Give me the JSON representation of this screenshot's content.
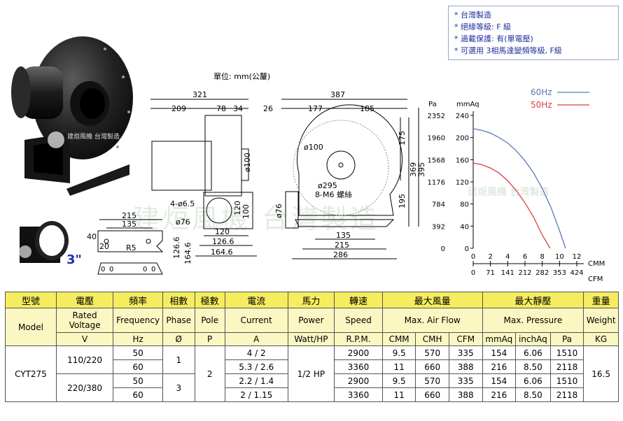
{
  "notes": [
    "* 台灣製造",
    "* 絕緣等級: F 級",
    "* 過載保護: 有(單電壓)",
    "* 可選用 3相馬達變頻等級, F級"
  ],
  "unit_label": "單位: mm(公釐)",
  "brand_watermark": "建烜風機 台灣製造",
  "brand_badge": "建烜風機 台灣製造",
  "flange_size": "3\"",
  "side_view": {
    "dims": [
      "321",
      "209",
      "78",
      "34",
      "4-ø6.5",
      "ø76",
      "ø100",
      "120",
      "100",
      "120",
      "126.6",
      "164.6"
    ]
  },
  "front_view": {
    "dims": [
      "387",
      "26",
      "177",
      "185",
      "ø100",
      "ø295",
      "8-M6 螺絲",
      "ø76",
      "135",
      "215",
      "286",
      "175",
      "195",
      "369",
      "395"
    ]
  },
  "flange_view": {
    "dims": [
      "215",
      "135",
      "40",
      "20",
      "R5",
      "126.6",
      "164.6"
    ]
  },
  "chart_data": {
    "type": "line",
    "y_left_unit": "Pa",
    "y_right_unit": "mmAq",
    "y_pa_ticks": [
      "2352",
      "1960",
      "1568",
      "1176",
      "784",
      "392",
      "0"
    ],
    "y_mmaq_ticks": [
      "240",
      "200",
      "160",
      "120",
      "80",
      "40",
      "0"
    ],
    "x_cmm_unit": "CMM",
    "x_cfm_unit": "CFM",
    "x_cmm_ticks": [
      "0",
      "2",
      "4",
      "6",
      "8",
      "10",
      "12"
    ],
    "x_cfm_ticks": [
      "0",
      "71",
      "141",
      "212",
      "282",
      "353",
      "424"
    ],
    "ylim_mmaq": [
      0,
      240
    ],
    "xlim_cmm": [
      0,
      12
    ],
    "legend_position": "top-right",
    "grid": false,
    "series": [
      {
        "name": "60Hz",
        "color": "#5a78b8",
        "x": [
          0,
          1,
          2,
          3,
          4,
          5,
          6,
          7,
          8,
          9,
          10,
          10.7
        ],
        "y": [
          216,
          213,
          208,
          200,
          190,
          176,
          158,
          136,
          108,
          74,
          32,
          0
        ]
      },
      {
        "name": "50Hz",
        "color": "#d84040",
        "x": [
          0,
          1,
          2,
          3,
          4,
          5,
          6,
          7,
          8,
          8.9
        ],
        "y": [
          154,
          151,
          145,
          136,
          122,
          104,
          82,
          56,
          24,
          0
        ]
      }
    ]
  },
  "table": {
    "header1": [
      "型號",
      "電壓",
      "頻率",
      "相數",
      "極數",
      "電流",
      "馬力",
      "轉速",
      "最大風量",
      "最大靜壓",
      "重量"
    ],
    "header2": [
      "Model",
      "Rated Voltage",
      "Frequency",
      "Phase",
      "Pole",
      "Current",
      "Power",
      "Speed",
      "Max. Air Flow",
      "Max. Pressure",
      "Weight"
    ],
    "header3": [
      "V",
      "Hz",
      "Ø",
      "P",
      "A",
      "Watt/HP",
      "R.P.M.",
      "CMM",
      "CMH",
      "CFM",
      "mmAq",
      "inchAq",
      "Pa",
      "KG"
    ],
    "model": "CYT275",
    "power": "1/2 HP",
    "pole": "2",
    "weight": "16.5",
    "voltage_groups": [
      {
        "voltage": "110/220",
        "phase": "1"
      },
      {
        "voltage": "220/380",
        "phase": "3"
      }
    ],
    "rows": [
      {
        "hz": "50",
        "current": "4 / 2",
        "rpm": "2900",
        "cmm": "9.5",
        "cmh": "570",
        "cfm": "335",
        "mmaq": "154",
        "inchaq": "6.06",
        "pa": "1510"
      },
      {
        "hz": "60",
        "current": "5.3 / 2.6",
        "rpm": "3360",
        "cmm": "11",
        "cmh": "660",
        "cfm": "388",
        "mmaq": "216",
        "inchaq": "8.50",
        "pa": "2118"
      },
      {
        "hz": "50",
        "current": "2.2 / 1.4",
        "rpm": "2900",
        "cmm": "9.5",
        "cmh": "570",
        "cfm": "335",
        "mmaq": "154",
        "inchaq": "6.06",
        "pa": "1510"
      },
      {
        "hz": "60",
        "current": "2 / 1.15",
        "rpm": "3360",
        "cmm": "11",
        "cmh": "660",
        "cfm": "388",
        "mmaq": "216",
        "inchaq": "8.50",
        "pa": "2118"
      }
    ]
  }
}
